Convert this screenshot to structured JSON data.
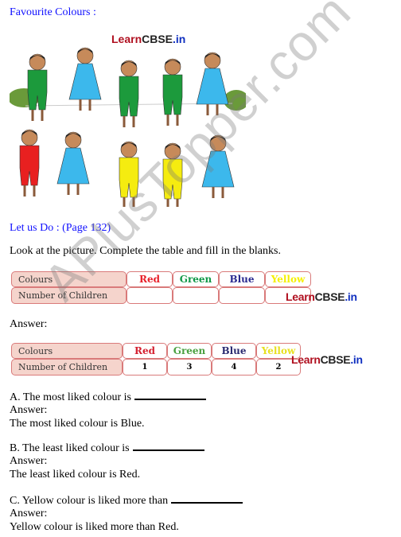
{
  "title": "Favourite Colours :",
  "picture": {
    "logo": {
      "part1": "Learn",
      "part2": "CBSE",
      "part3": ".in"
    },
    "children": [
      {
        "kind": "boy",
        "colour": "green"
      },
      {
        "kind": "girl",
        "colour": "blue"
      },
      {
        "kind": "boy",
        "colour": "green"
      },
      {
        "kind": "boy",
        "colour": "green"
      },
      {
        "kind": "girl",
        "colour": "blue"
      },
      {
        "kind": "boy",
        "colour": "red"
      },
      {
        "kind": "girl",
        "colour": "blue"
      },
      {
        "kind": "boy",
        "colour": "yellow"
      },
      {
        "kind": "boy",
        "colour": "yellow"
      },
      {
        "kind": "girl",
        "colour": "blue"
      }
    ]
  },
  "section": "Let us Do : (Page 132)",
  "instruction": "Look at the picture. Complete the table and fill in the blanks.",
  "table_blank": {
    "row1_label": "Colours",
    "row2_label": "Number of Children",
    "columns": [
      {
        "label": "Red",
        "color": "#e8202a",
        "value": ""
      },
      {
        "label": "Green",
        "color": "#109848",
        "value": ""
      },
      {
        "label": "Blue",
        "color": "#2a2a90",
        "value": ""
      },
      {
        "label": "Yellow",
        "color": "#f5f000",
        "value": ""
      }
    ]
  },
  "answer_label": "Answer:",
  "table_answer": {
    "row1_label": "Colours",
    "row2_label": "Number of Children",
    "columns": [
      {
        "label": "Red",
        "color": "#d42030",
        "value": "1"
      },
      {
        "label": "Green",
        "color": "#4aa040",
        "value": "3"
      },
      {
        "label": "Blue",
        "color": "#2a2a70",
        "value": "4"
      },
      {
        "label": "Yellow",
        "color": "#e8e020",
        "value": "2"
      }
    ]
  },
  "questions": [
    {
      "q": "A. The most liked colour is",
      "answer_label": "Answer:",
      "answer": "The most liked colour is Blue."
    },
    {
      "q": "B. The least liked colour is",
      "answer_label": "Answer:",
      "answer": "The least liked colour is Red."
    },
    {
      "q": "C. Yellow colour is liked more than",
      "answer_label": "Answer:",
      "answer": "Yellow colour is liked more than Red."
    }
  ],
  "watermark": "APlusTopper.com"
}
